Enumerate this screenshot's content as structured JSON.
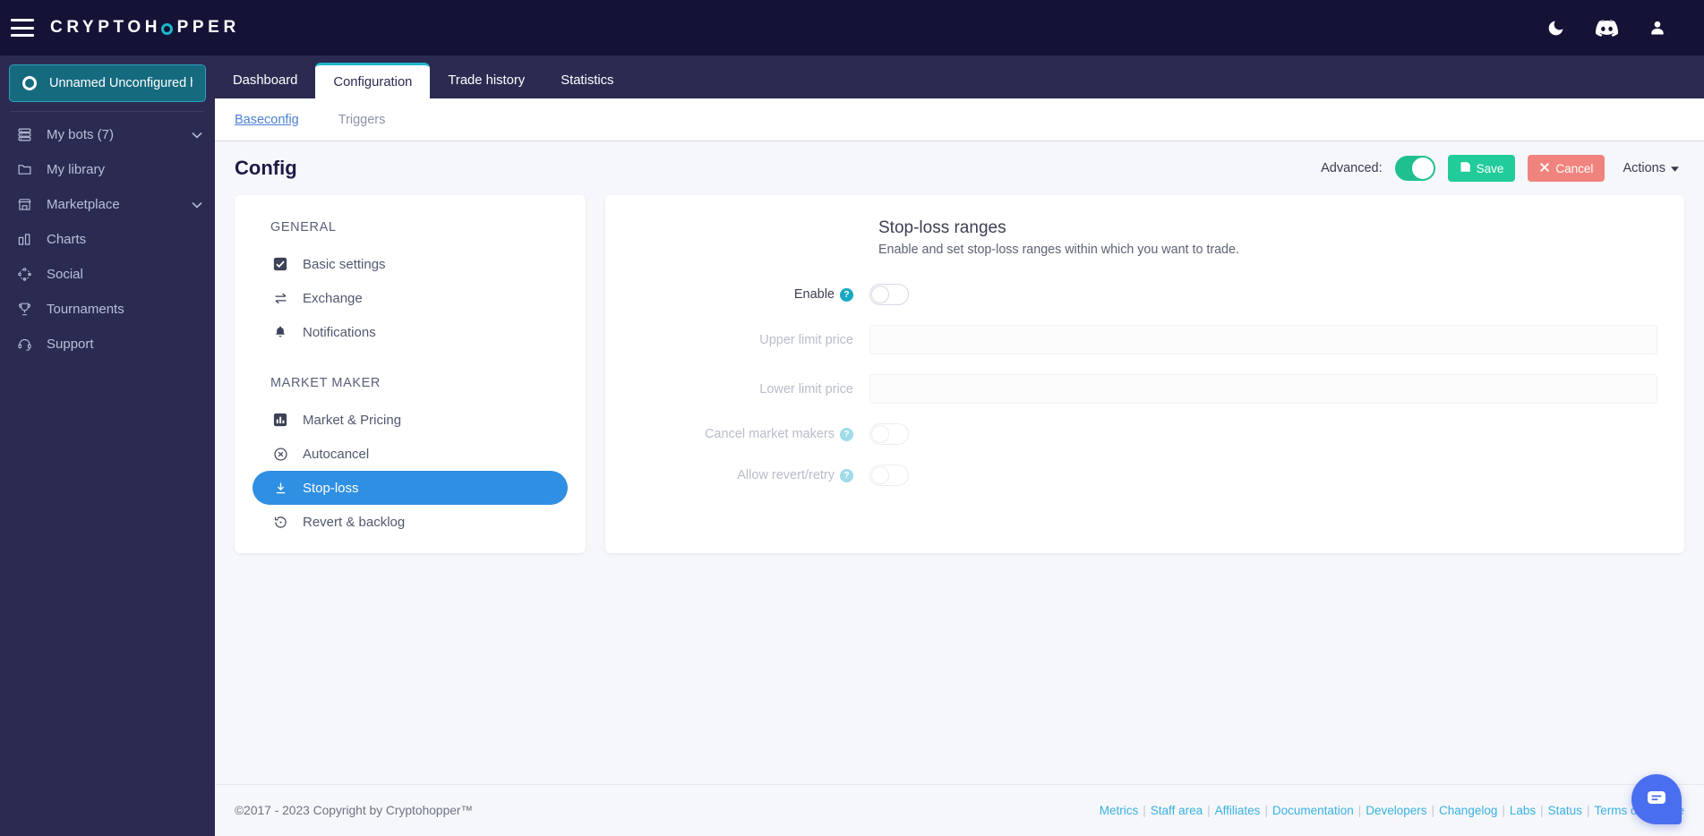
{
  "topbar": {
    "brand_before": "CRYPTOH",
    "brand_after": "PPER",
    "menu_icon": "hamburger-menu-icon",
    "icons": [
      {
        "name": "dark-mode-moon-icon",
        "glyph": "moon"
      },
      {
        "name": "discord-icon",
        "glyph": "discord"
      },
      {
        "name": "user-profile-icon",
        "glyph": "user"
      }
    ]
  },
  "sidebar": {
    "bot_selector": {
      "label": "Unnamed Unconfigured ho…"
    },
    "items": [
      {
        "label": "My bots (7)",
        "icon": "server-stack-icon",
        "caret": "⌄"
      },
      {
        "label": "My library",
        "icon": "folder-icon",
        "caret": ""
      },
      {
        "label": "Marketplace",
        "icon": "store-icon",
        "caret": "⌄"
      },
      {
        "label": "Charts",
        "icon": "bar-chart-icon",
        "caret": ""
      },
      {
        "label": "Social",
        "icon": "social-network-icon",
        "caret": ""
      },
      {
        "label": "Tournaments",
        "icon": "trophy-icon",
        "caret": ""
      },
      {
        "label": "Support",
        "icon": "headset-icon",
        "caret": ""
      }
    ]
  },
  "tabs": [
    {
      "label": "Dashboard",
      "active": false
    },
    {
      "label": "Configuration",
      "active": true
    },
    {
      "label": "Trade history",
      "active": false
    },
    {
      "label": "Statistics",
      "active": false
    }
  ],
  "subtabs": [
    {
      "label": "Baseconfig",
      "active": true
    },
    {
      "label": "Triggers",
      "active": false
    }
  ],
  "page": {
    "title": "Config",
    "advanced_label": "Advanced:",
    "advanced_on": true,
    "save_label": "Save",
    "cancel_label": "Cancel",
    "actions_label": "Actions"
  },
  "config_menu": {
    "groups": [
      {
        "title": "GENERAL",
        "items": [
          {
            "label": "Basic settings",
            "icon": "checkbox-checked-icon",
            "active": false
          },
          {
            "label": "Exchange",
            "icon": "exchange-arrows-icon",
            "active": false
          },
          {
            "label": "Notifications",
            "icon": "bell-icon",
            "active": false
          }
        ]
      },
      {
        "title": "MARKET MAKER",
        "items": [
          {
            "label": "Market & Pricing",
            "icon": "bar-chart-square-icon",
            "active": false
          },
          {
            "label": "Autocancel",
            "icon": "circle-x-icon",
            "active": false
          },
          {
            "label": "Stop-loss",
            "icon": "download-arrow-icon",
            "active": true
          },
          {
            "label": "Revert & backlog",
            "icon": "history-revert-icon",
            "active": false
          }
        ]
      }
    ]
  },
  "form": {
    "section_title": "Stop-loss ranges",
    "section_subtitle": "Enable and set stop-loss ranges within which you want to trade.",
    "rows": [
      {
        "label": "Enable",
        "type": "toggle",
        "help": true,
        "enabled": true,
        "on": false,
        "value": ""
      },
      {
        "label": "Upper limit price",
        "type": "input",
        "help": false,
        "enabled": false,
        "value": ""
      },
      {
        "label": "Lower limit price",
        "type": "input",
        "help": false,
        "enabled": false,
        "value": ""
      },
      {
        "label": "Cancel market makers",
        "type": "toggle",
        "help": true,
        "enabled": false,
        "on": false,
        "value": ""
      },
      {
        "label": "Allow revert/retry",
        "type": "toggle",
        "help": true,
        "enabled": false,
        "on": false,
        "value": ""
      }
    ],
    "help_glyph": "?"
  },
  "footer": {
    "copyright": "©2017 - 2023  Copyright by Cryptohopper™",
    "links": [
      "Metrics",
      "Staff area",
      "Affiliates",
      "Documentation",
      "Developers",
      "Changelog",
      "Labs",
      "Status",
      "Terms of Service"
    ]
  },
  "chat": {
    "icon": "chat-message-icon"
  },
  "colors": {
    "topbar_bg": "#141336",
    "sidebar_bg": "#2b2b52",
    "accent_teal": "#1fb6c9",
    "active_blue": "#2f8fe3",
    "save_green": "#21cc9a",
    "cancel_red": "#f0837e",
    "link_blue": "#38b0e0",
    "chat_blue": "#4a6ef0"
  }
}
